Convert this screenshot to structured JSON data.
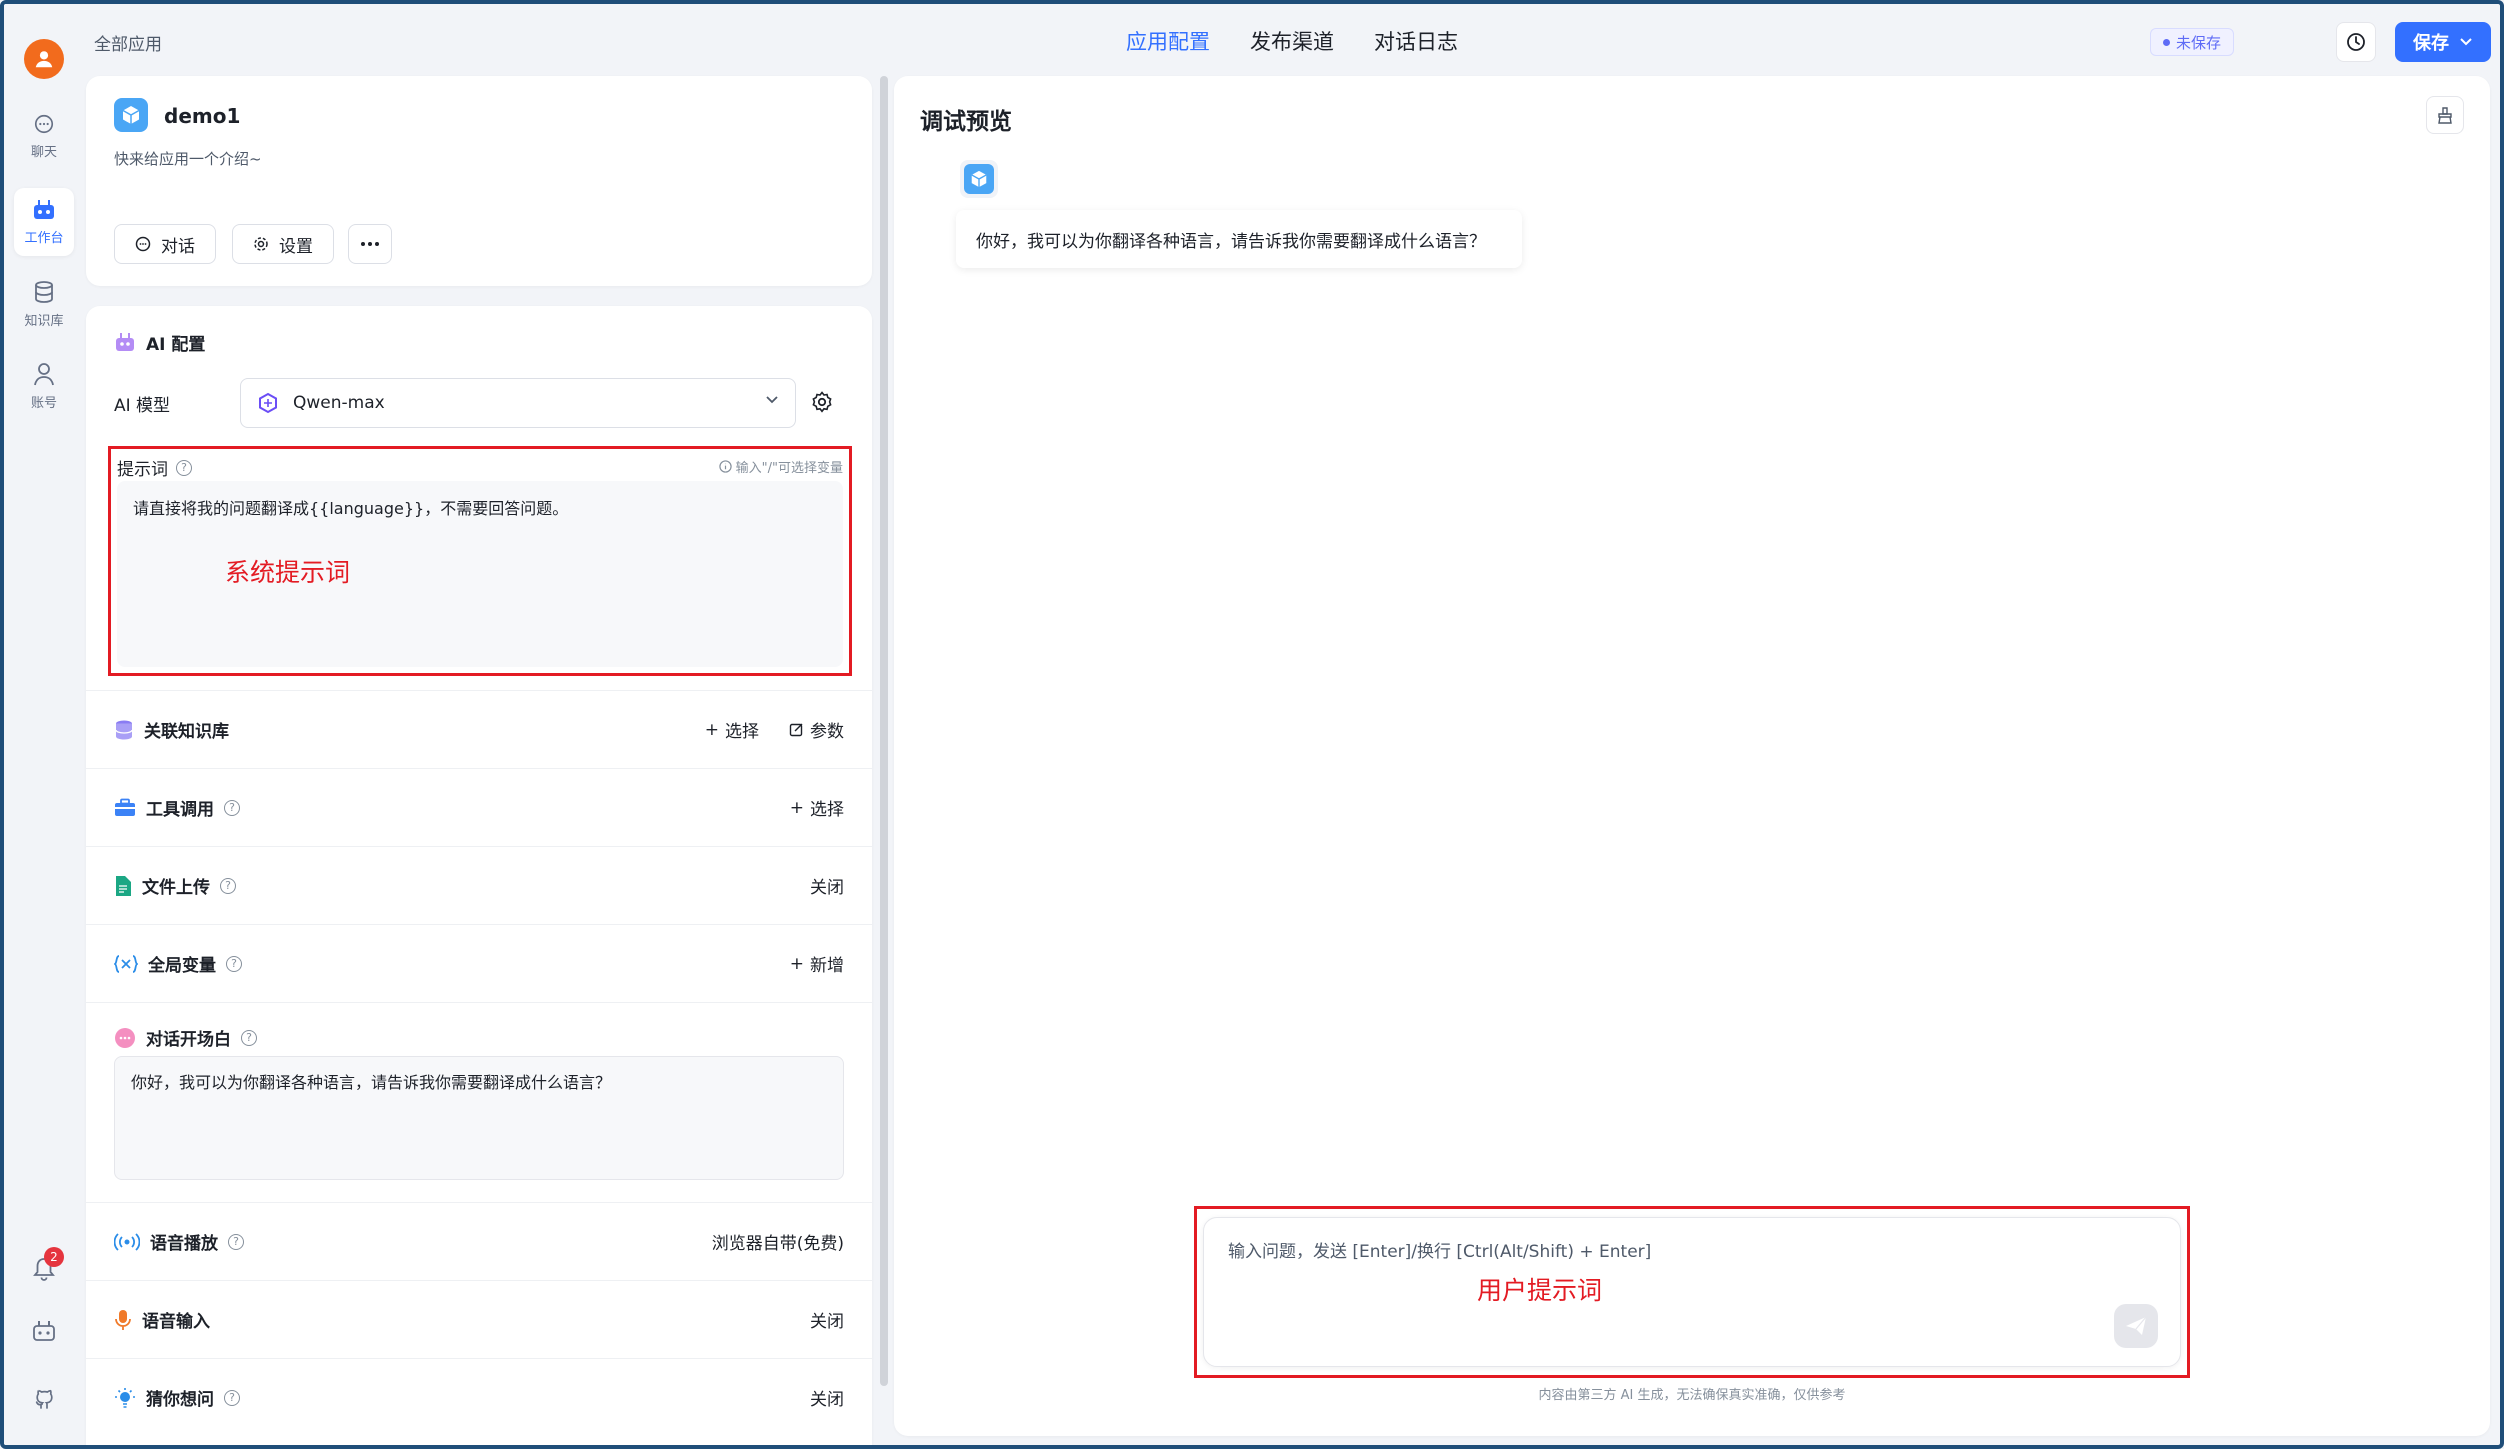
{
  "nav": {
    "items": [
      {
        "label": "聊天"
      },
      {
        "label": "工作台"
      },
      {
        "label": "知识库"
      },
      {
        "label": "账号"
      }
    ],
    "notification_count": "2"
  },
  "header": {
    "breadcrumb": "全部应用",
    "tabs": [
      {
        "label": "应用配置"
      },
      {
        "label": "发布渠道"
      },
      {
        "label": "对话日志"
      }
    ],
    "status": "未保存",
    "save_label": "保存"
  },
  "app": {
    "name": "demo1",
    "intro": "快来给应用一个介绍~",
    "chat_btn": "对话",
    "settings_btn": "设置"
  },
  "config": {
    "section_title": "AI 配置",
    "model_label": "AI 模型",
    "model_value": "Qwen-max",
    "prompt_label": "提示词",
    "prompt_hint": "输入\"/\"可选择变量",
    "prompt_text": "请直接将我的问题翻译成{{language}}，不需要回答问题。",
    "prompt_annotation": "系统提示词",
    "rows": [
      {
        "label": "关联知识库",
        "action": "选择",
        "action2": "参数"
      },
      {
        "label": "工具调用",
        "action": "选择"
      },
      {
        "label": "文件上传",
        "action": "关闭"
      },
      {
        "label": "全局变量",
        "action": "新增"
      }
    ],
    "opener_label": "对话开场白",
    "opener_text": "你好，我可以为你翻译各种语言，请告诉我你需要翻译成什么语言？",
    "rows2": [
      {
        "label": "语音播放",
        "action": "浏览器自带(免费)"
      },
      {
        "label": "语音输入",
        "action": "关闭"
      },
      {
        "label": "猜你想问",
        "action": "关闭"
      }
    ]
  },
  "preview": {
    "title": "调试预览",
    "bot_message": "你好，我可以为你翻译各种语言，请告诉我你需要翻译成什么语言？",
    "input_placeholder": "输入问题，发送 [Enter]/换行 [Ctrl(Alt/Shift) + Enter]",
    "user_annotation": "用户提示词",
    "disclaimer": "内容由第三方 AI 生成，无法确保真实准确，仅供参考"
  },
  "colors": {
    "accent": "#3370ff",
    "annotation": "#e31b23"
  }
}
